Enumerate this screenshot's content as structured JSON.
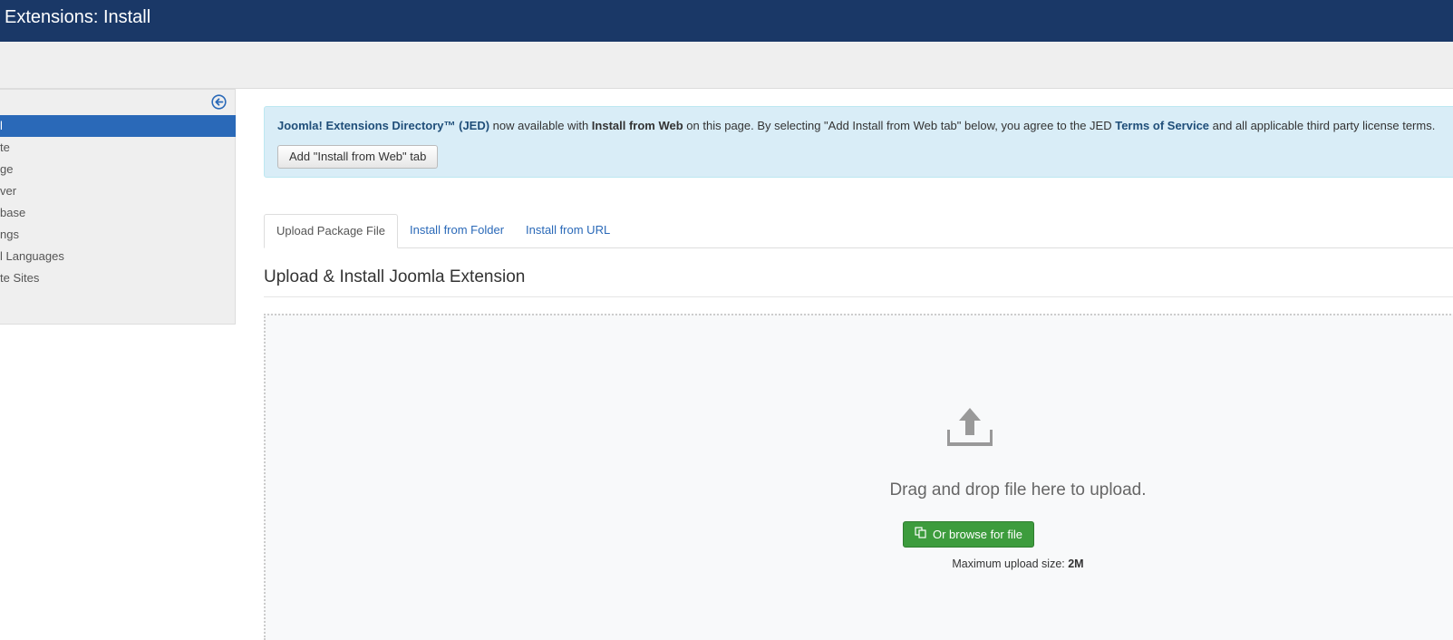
{
  "header": {
    "title": "Extensions: Install"
  },
  "sidebar": {
    "toggle_icon": "arrow-left-circle-icon",
    "items": [
      {
        "label": "Install",
        "visible": "l"
      },
      {
        "label": "Update",
        "visible": "te"
      },
      {
        "label": "Manage",
        "visible": "ge"
      },
      {
        "label": "Discover",
        "visible": "ver"
      },
      {
        "label": "Database",
        "visible": "base"
      },
      {
        "label": "Warnings",
        "visible": "ngs"
      },
      {
        "label": "Install Languages",
        "visible": "l Languages"
      },
      {
        "label": "Update Sites",
        "visible": "te Sites"
      }
    ]
  },
  "notice": {
    "jed_name": "Joomla! Extensions Directory™ (JED)",
    "text_1": " now available with ",
    "install_from_web": "Install from Web",
    "text_2": " on this page.  By selecting \"Add Install from Web tab\" below, you agree to the JED ",
    "terms": "Terms of Service",
    "text_3": " and all applicable third party license terms.",
    "button_label": "Add \"Install from Web\" tab"
  },
  "tabs": [
    {
      "label": "Upload Package File",
      "active": true
    },
    {
      "label": "Install from Folder",
      "active": false
    },
    {
      "label": "Install from URL",
      "active": false
    }
  ],
  "upload": {
    "section_title": "Upload & Install Joomla Extension",
    "drag_text": "Drag and drop file here to upload.",
    "browse_label": "Or browse for file",
    "max_label": "Maximum upload size: ",
    "max_value": "2M"
  },
  "colors": {
    "header_bg": "#1a3867",
    "accent": "#2a69b8",
    "success": "#3d9c3d",
    "info_bg": "#d9edf7"
  }
}
